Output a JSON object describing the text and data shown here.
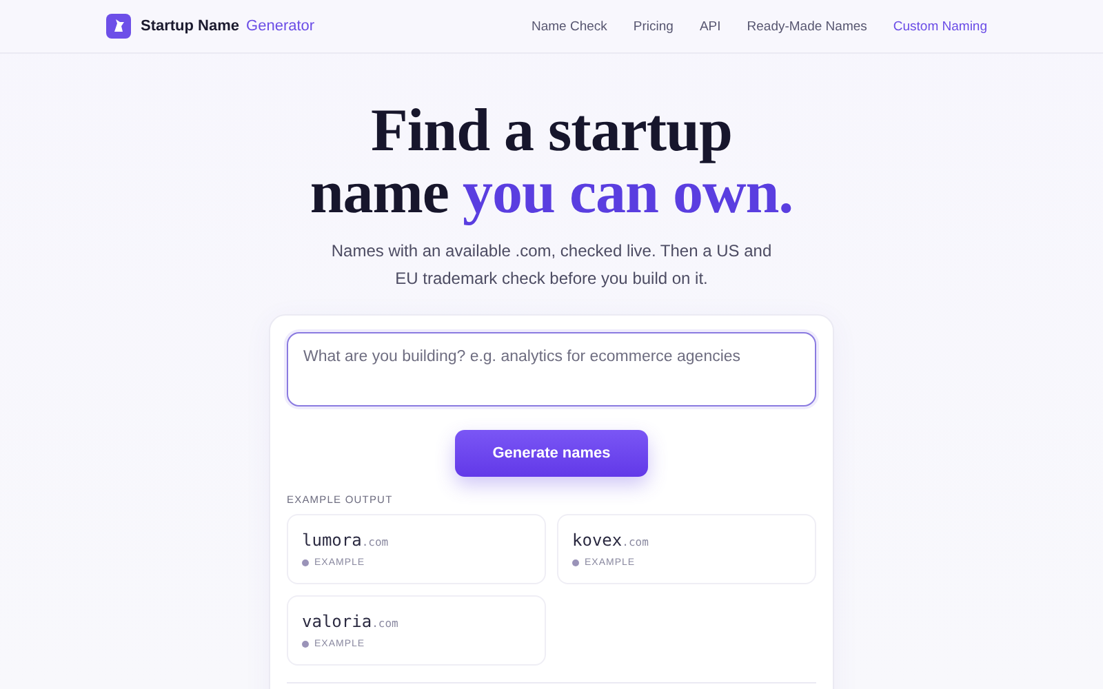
{
  "header": {
    "brand": {
      "name": "Startup Name",
      "accent": "Generator"
    },
    "nav": [
      {
        "label": "Name Check",
        "selected": false
      },
      {
        "label": "Pricing",
        "selected": false
      },
      {
        "label": "API",
        "selected": false
      },
      {
        "label": "Ready-Made Names",
        "selected": false
      },
      {
        "label": "Custom Naming",
        "selected": true
      }
    ]
  },
  "hero": {
    "headline": {
      "line_1": "Find a startup",
      "line_2_plain": "name",
      "line_2_accent": "you can own."
    },
    "subtitle": "Names with an available .com, checked live. Then a US and EU trademark check before you build on it."
  },
  "form": {
    "input": {
      "placeholder": "What are you building? e.g. analytics for ecommerce agencies"
    },
    "button": "Generate names",
    "examples_label": "EXAMPLE OUTPUT",
    "examples": [
      {
        "name": "lumora",
        "tld": ".com",
        "tag": "EXAMPLE"
      },
      {
        "name": "kovex",
        "tld": ".com",
        "tag": "EXAMPLE"
      },
      {
        "name": "valoria",
        "tld": ".com",
        "tag": "EXAMPLE"
      }
    ]
  }
}
